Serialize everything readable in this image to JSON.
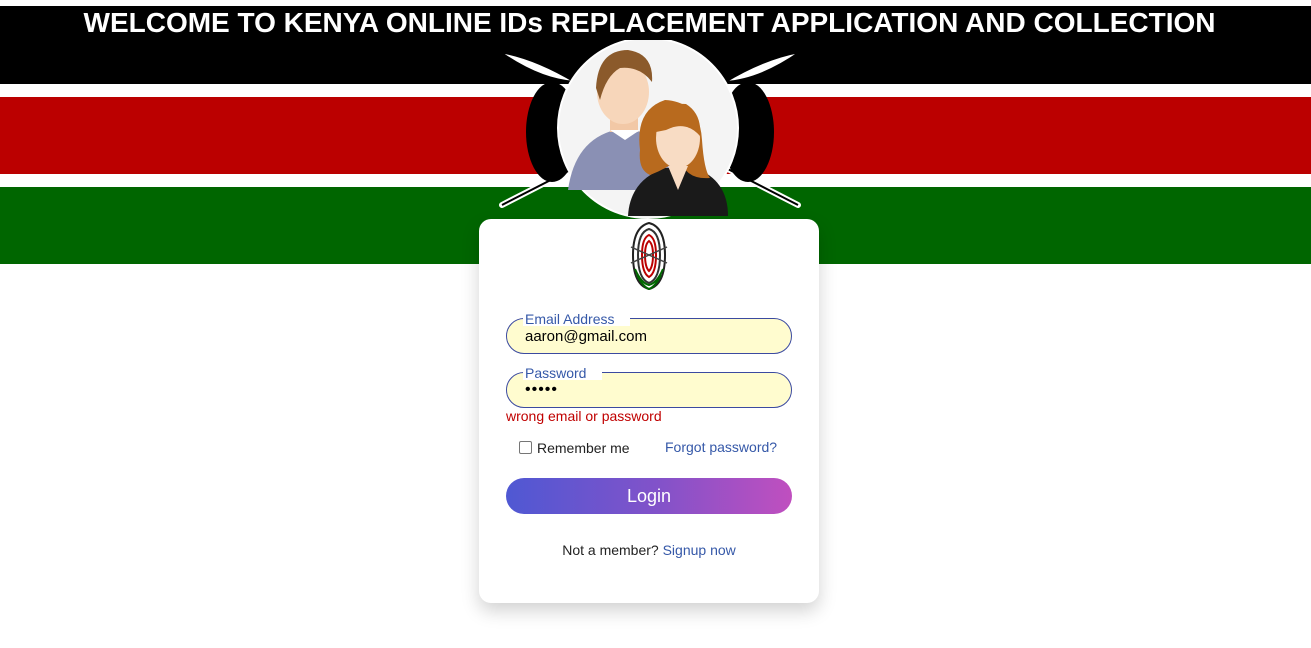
{
  "header": {
    "title": "WELCOME TO KENYA ONLINE IDs REPLACEMENT APPLICATION AND COLLECTION"
  },
  "colors": {
    "black": "#000000",
    "red": "#bb0000",
    "green": "#006600",
    "accent": "#3558a8",
    "error": "#c00000",
    "input_bg": "#fffccf"
  },
  "icons": {
    "emblem": "users-shield-emblem-icon",
    "fingerprint": "kenya-fingerprint-logo-icon"
  },
  "login_form": {
    "email_label": "Email Address",
    "email_value": "aaron@gmail.com",
    "password_label": "Password",
    "password_value": "•••••",
    "error_message": "wrong email or password",
    "remember_label": "Remember me",
    "remember_checked": false,
    "forgot_link": "Forgot password?",
    "login_button": "Login",
    "signup_prompt": "Not a member?",
    "signup_link": "Signup now"
  }
}
